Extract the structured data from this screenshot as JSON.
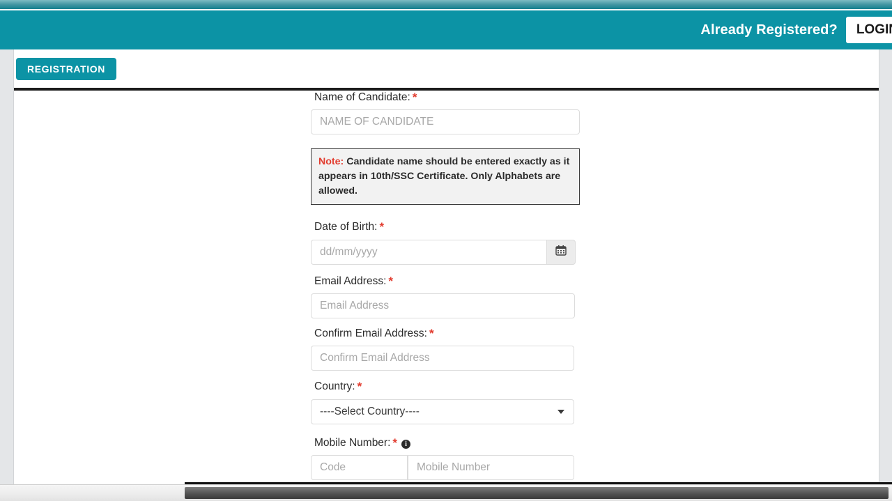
{
  "header": {
    "already_registered_label": "Already Registered?",
    "login_button_label": "LOGIN",
    "bar_color": "#0c93a5"
  },
  "tabs": {
    "registration_label": "REGISTRATION"
  },
  "form": {
    "name": {
      "label": "Name of Candidate:",
      "required_marker": "*",
      "placeholder": "NAME OF CANDIDATE",
      "value": ""
    },
    "note": {
      "label": "Note:",
      "text": " Candidate name should be entered exactly as it appears in 10th/SSC Certificate. Only Alphabets are allowed."
    },
    "dob": {
      "label": "Date of Birth:",
      "required_marker": "*",
      "placeholder": "dd/mm/yyyy",
      "value": "",
      "calendar_icon": "calendar-icon"
    },
    "email": {
      "label": "Email Address:",
      "required_marker": "*",
      "placeholder": "Email Address",
      "value": ""
    },
    "confirm_email": {
      "label": "Confirm Email Address:",
      "required_marker": "*",
      "placeholder": "Confirm Email Address",
      "value": ""
    },
    "country": {
      "label": "Country:",
      "required_marker": "*",
      "selected": "----Select Country----"
    },
    "mobile": {
      "label": "Mobile Number:",
      "required_marker": "*",
      "info_icon": "i",
      "code_placeholder": "Code",
      "code_value": "",
      "number_placeholder": "Mobile Number",
      "number_value": ""
    }
  },
  "colors": {
    "accent_teal": "#0c93a5",
    "required_red": "#e23b2e",
    "note_bg": "#f2f2f2",
    "page_bg": "#e4e6e8"
  }
}
